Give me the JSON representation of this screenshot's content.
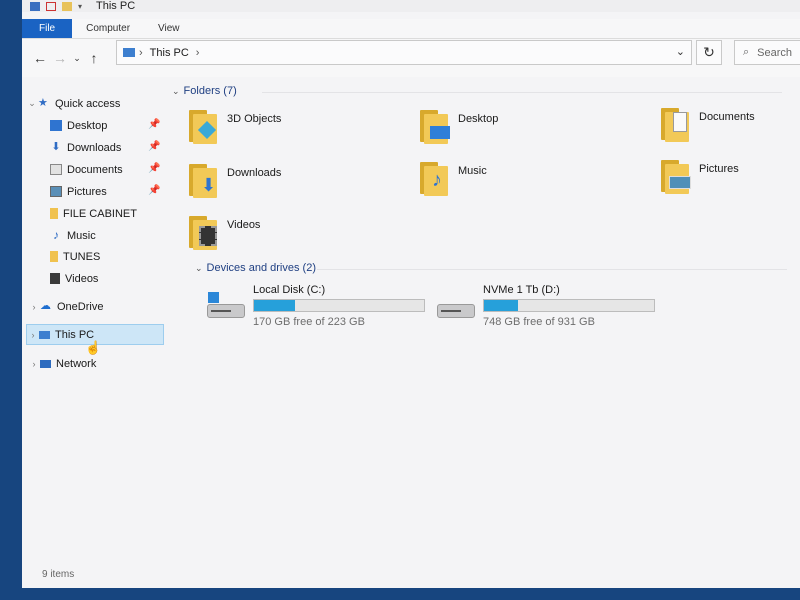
{
  "window": {
    "title": "This PC"
  },
  "ribbon": {
    "tabs": [
      "File",
      "Computer",
      "View"
    ]
  },
  "address": {
    "path": [
      "This PC"
    ],
    "search_placeholder": "Search"
  },
  "sidebar": {
    "quick_access": "Quick access",
    "quick_items": [
      {
        "label": "Desktop",
        "pinned": true,
        "icon": "desktop-icon"
      },
      {
        "label": "Downloads",
        "pinned": true,
        "icon": "download-icon"
      },
      {
        "label": "Documents",
        "pinned": true,
        "icon": "documents-icon"
      },
      {
        "label": "Pictures",
        "pinned": true,
        "icon": "pictures-icon"
      },
      {
        "label": "FILE CABINET",
        "pinned": false,
        "icon": "folder-icon"
      },
      {
        "label": "Music",
        "pinned": false,
        "icon": "music-icon"
      },
      {
        "label": "TUNES",
        "pinned": false,
        "icon": "folder-icon"
      },
      {
        "label": "Videos",
        "pinned": false,
        "icon": "videos-icon"
      }
    ],
    "onedrive": "OneDrive",
    "this_pc": "This PC",
    "network": "Network"
  },
  "main": {
    "folders_header": "Folders (7)",
    "folders": [
      "3D Objects",
      "Desktop",
      "Documents",
      "Downloads",
      "Music",
      "Pictures",
      "Videos"
    ],
    "drives_header": "Devices and drives (2)",
    "drives": [
      {
        "name": "Local Disk (C:)",
        "free": "170 GB free of 223 GB",
        "used_fraction": 0.24
      },
      {
        "name": "NVMe 1 Tb (D:)",
        "free": "748 GB free of 931 GB",
        "used_fraction": 0.2
      }
    ]
  },
  "status": {
    "items": "9 items"
  },
  "colors": {
    "accent": "#1a63c3",
    "folder": "#f2c957",
    "drive_bar": "#26a0da",
    "selection": "#cde6f7"
  }
}
